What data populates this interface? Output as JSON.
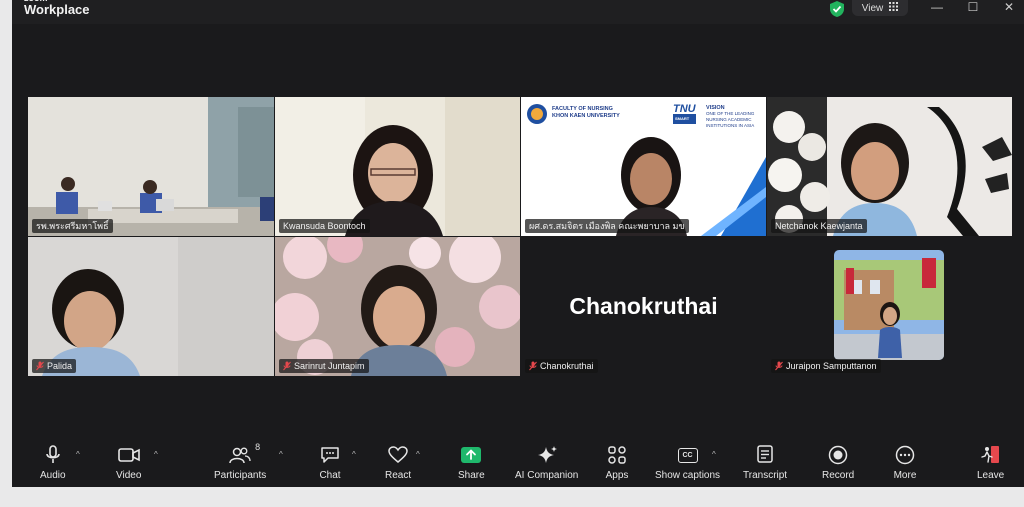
{
  "app": {
    "brand_line1": "zoom",
    "brand_line2": "Workplace"
  },
  "titlebar": {
    "view_label": "View",
    "minimize": "—",
    "maximize": "☐",
    "close": "✕"
  },
  "participants": [
    {
      "name": "รพ.พระศรีมหาโพธิ์",
      "muted": false,
      "active": true
    },
    {
      "name": "Kwansuda Boontoch",
      "muted": false,
      "active": false
    },
    {
      "name": "ผศ.ดร.สมจิตร เมืองพิล คณะพยาบาล มข",
      "muted": false,
      "active": false
    },
    {
      "name": "Netchanok Kaewjanta",
      "muted": false,
      "active": false
    },
    {
      "name": "Palida",
      "muted": true,
      "active": false
    },
    {
      "name": "Sarinrut Juntapim",
      "muted": true,
      "active": false
    },
    {
      "name": "Chanokruthai",
      "muted": true,
      "active": false,
      "display_name": "Chanokruthai"
    },
    {
      "name": "Juraipon Samputtanon",
      "muted": true,
      "active": false
    }
  ],
  "slide": {
    "faculty_line1": "FACULTY OF NURSING",
    "faculty_line2": "KHON KAEN UNIVERSITY",
    "logo_text": "TNU",
    "logo_sub": "SMART",
    "vision_title": "VISION",
    "vision_text": "ONE OF THE LEADING NURSING ACADEMIC INSTITUTIONS IN ASIA"
  },
  "toolbar": {
    "audio": "Audio",
    "video": "Video",
    "participants": "Participants",
    "participants_count": "8",
    "chat": "Chat",
    "react": "React",
    "share": "Share",
    "ai_companion": "AI Companion",
    "apps": "Apps",
    "show_captions": "Show captions",
    "cc": "CC",
    "transcript": "Transcript",
    "record": "Record",
    "more": "More",
    "leave": "Leave"
  },
  "colors": {
    "accent_green": "#3dd68c",
    "share_green": "#1fb86c",
    "leave_red": "#e5484d"
  }
}
